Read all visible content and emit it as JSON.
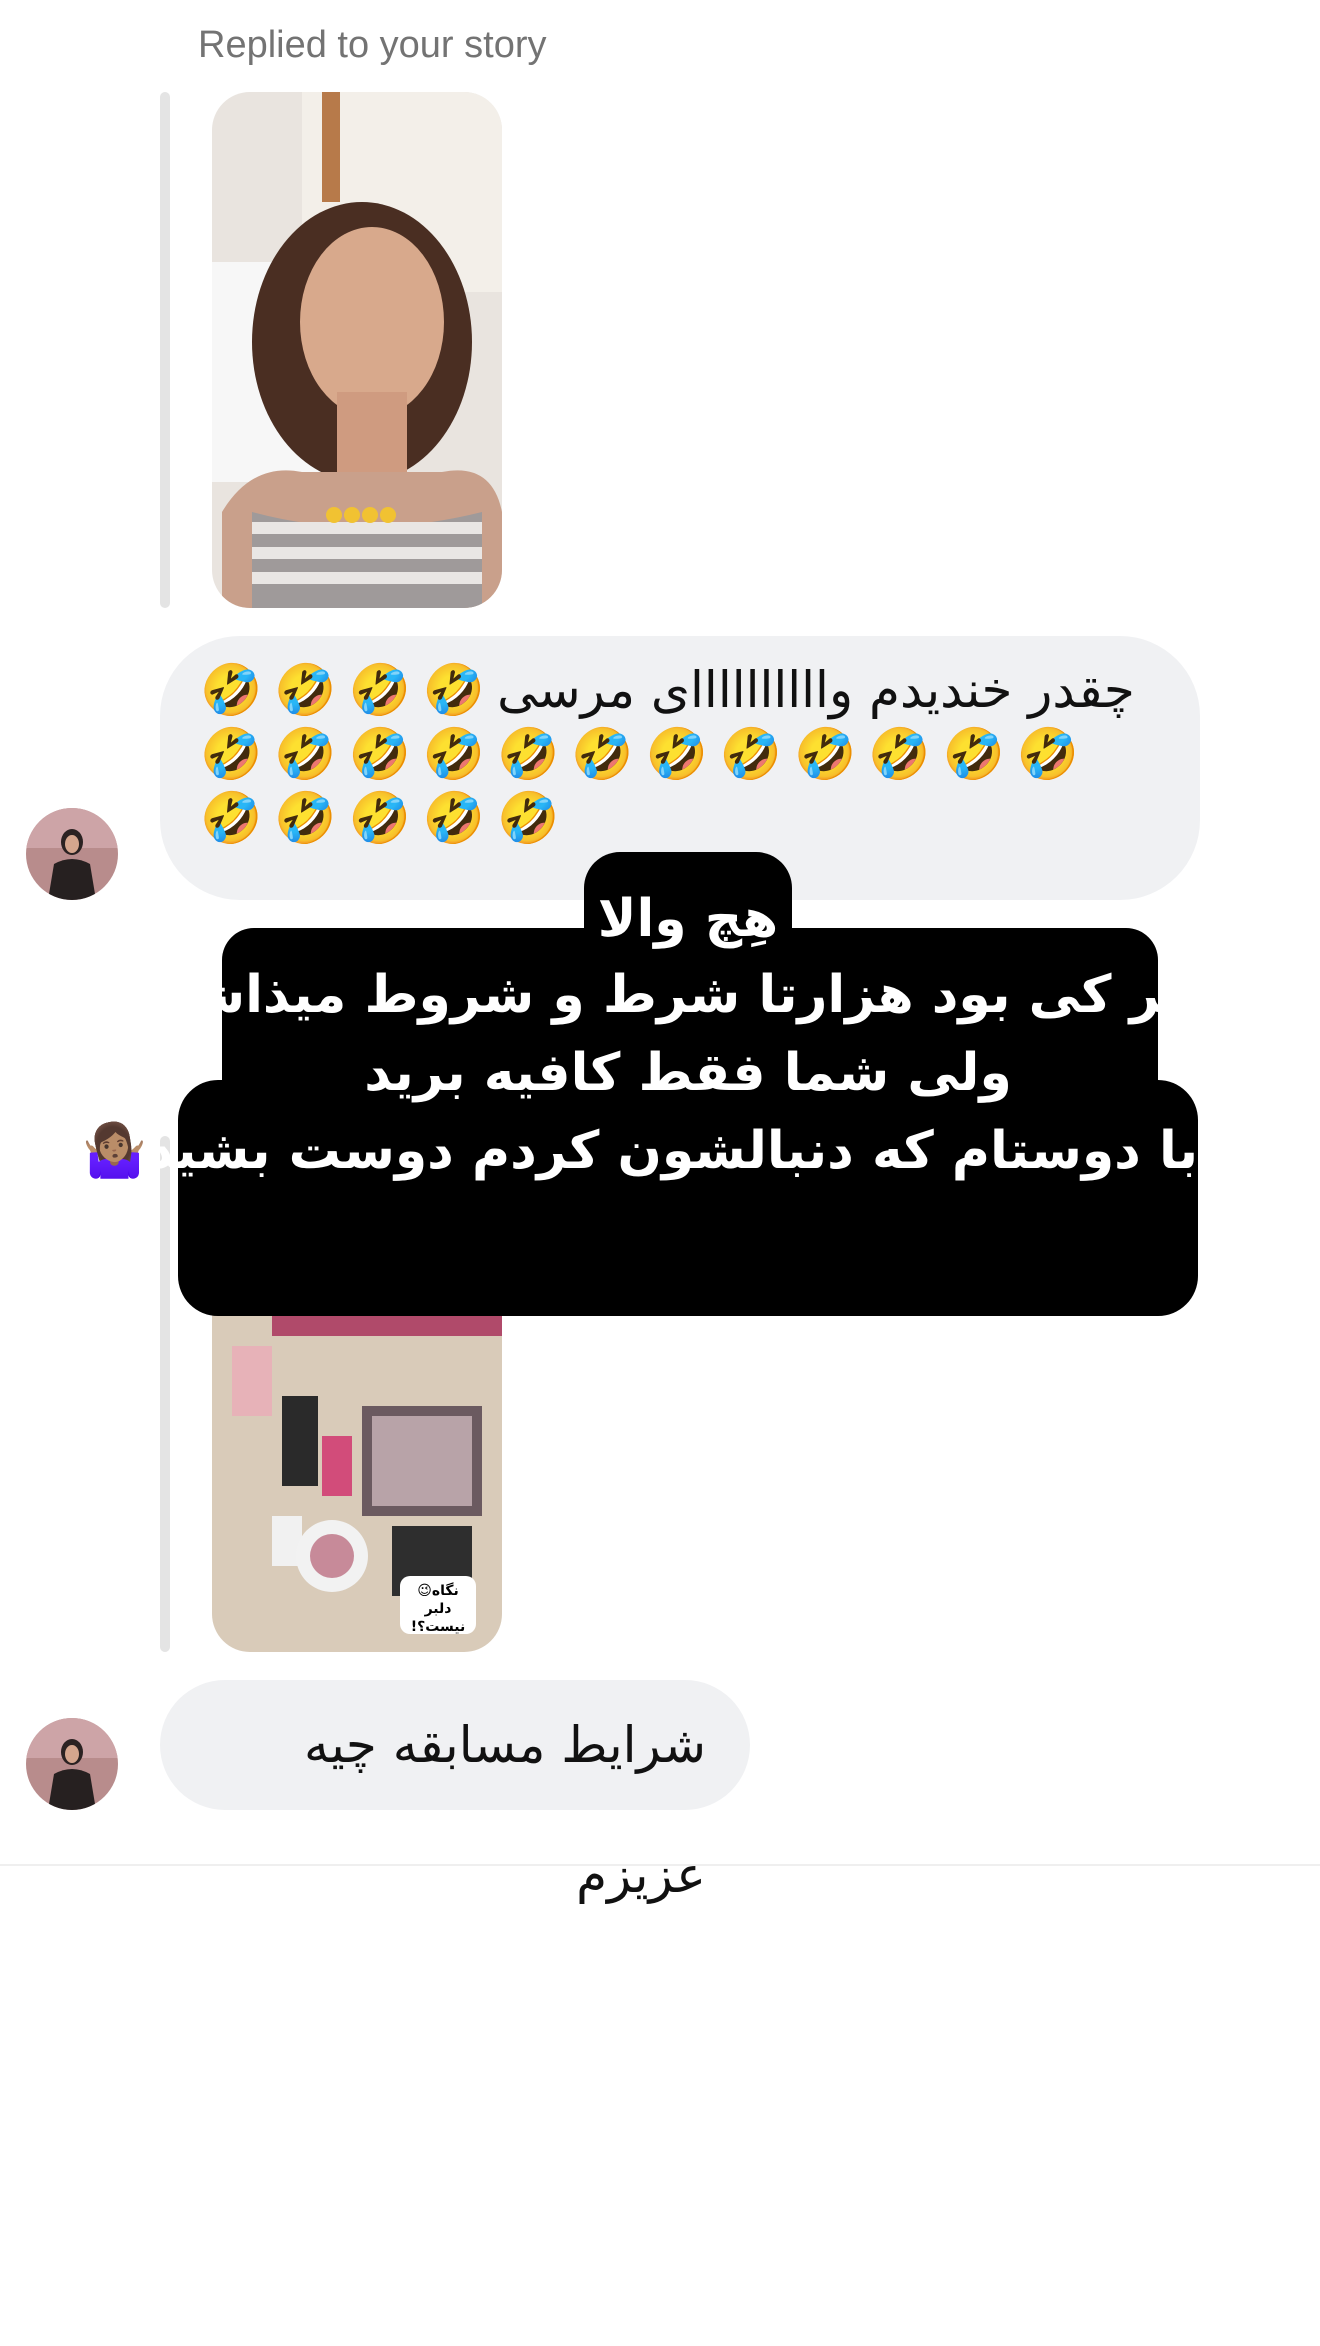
{
  "thread": {
    "reply_label": "Replied to your story",
    "message1": {
      "text": "چقدر خندیدم واااااااااای مرسی",
      "emoji": "🤣",
      "emoji_rows": [
        4,
        12,
        5
      ]
    },
    "overlay": {
      "line1": "هِچ والا",
      "line2": "هر کی بود هزارتا شرط و شروط میذاشت",
      "line3": "ولی شما فقط کافیه برید",
      "line4": "با دوستام که دنبالشون کردم دوست بشید🤷🏽‍♀️"
    },
    "story2_sticker": {
      "line1": "نگاه😉",
      "line2": "دلبر نیست؟!"
    },
    "message2": {
      "text": "شرایط مسابقه چیه عزیزم"
    }
  },
  "colors": {
    "bubble_bg": "#f0f1f3",
    "reply_bar": "#e4e4e4",
    "label_gray": "#737373",
    "overlay_bg": "#000000"
  },
  "icons": {
    "avatar": "user-avatar-photo",
    "emoji": "rolling-on-floor-laughing"
  }
}
